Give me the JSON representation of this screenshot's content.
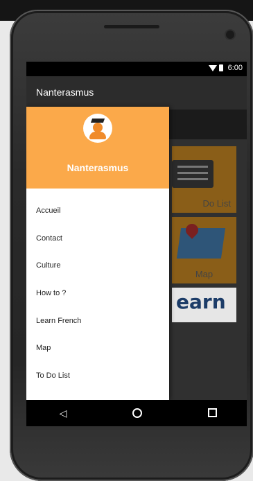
{
  "status_bar": {
    "time": "6:00"
  },
  "app_bar": {
    "title": "Nanterasmus"
  },
  "drawer": {
    "header_title": "Nanterasmus",
    "menu_items": [
      "Accueil",
      "Contact",
      "Culture",
      "How to ?",
      "Learn French",
      "Map",
      "To Do List"
    ]
  },
  "tiles": [
    "Do List",
    "Map",
    "earn"
  ],
  "nav": {
    "back": "◁"
  },
  "colors": {
    "drawer_header": "#fba94a",
    "accent": "#f08b2a"
  }
}
